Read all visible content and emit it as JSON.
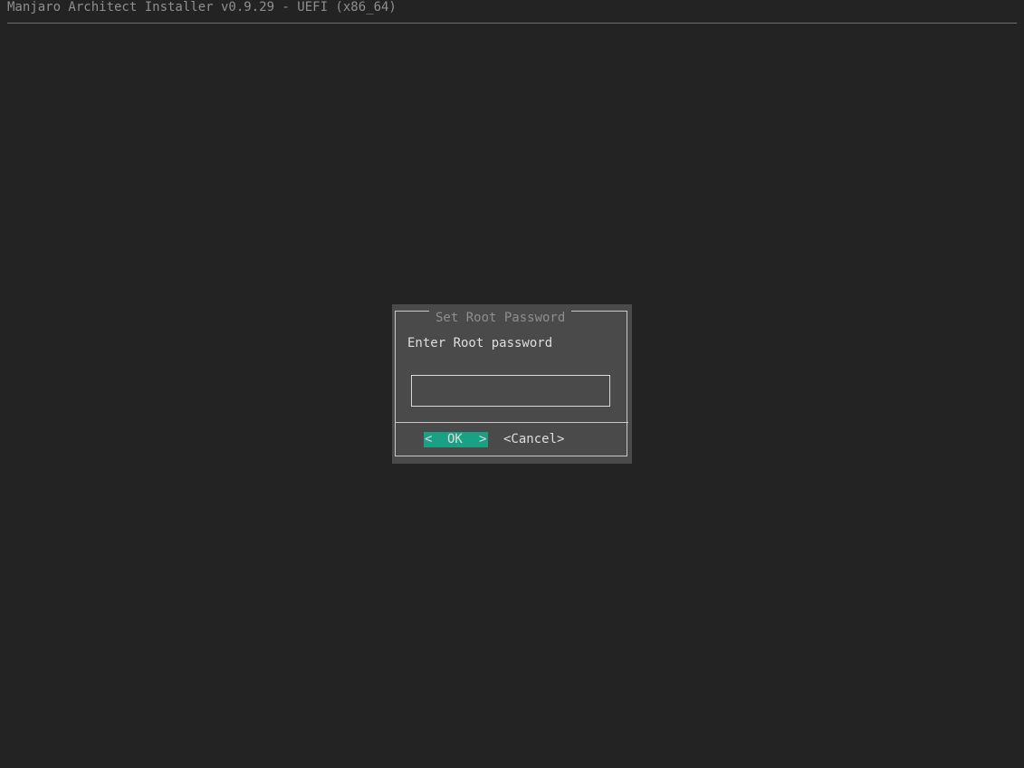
{
  "backtitle": "Manjaro Architect Installer v0.9.29 - UEFI (x86_64)",
  "dialog": {
    "title": "Set Root Password",
    "prompt": "Enter Root password",
    "password_value": "",
    "ok": {
      "left_bracket": "<",
      "label": "OK",
      "right_bracket": ">"
    },
    "cancel_label": "<Cancel>"
  },
  "colors": {
    "background": "#232323",
    "dialog_background": "#4a4a4a",
    "accent": "#1aa082"
  }
}
